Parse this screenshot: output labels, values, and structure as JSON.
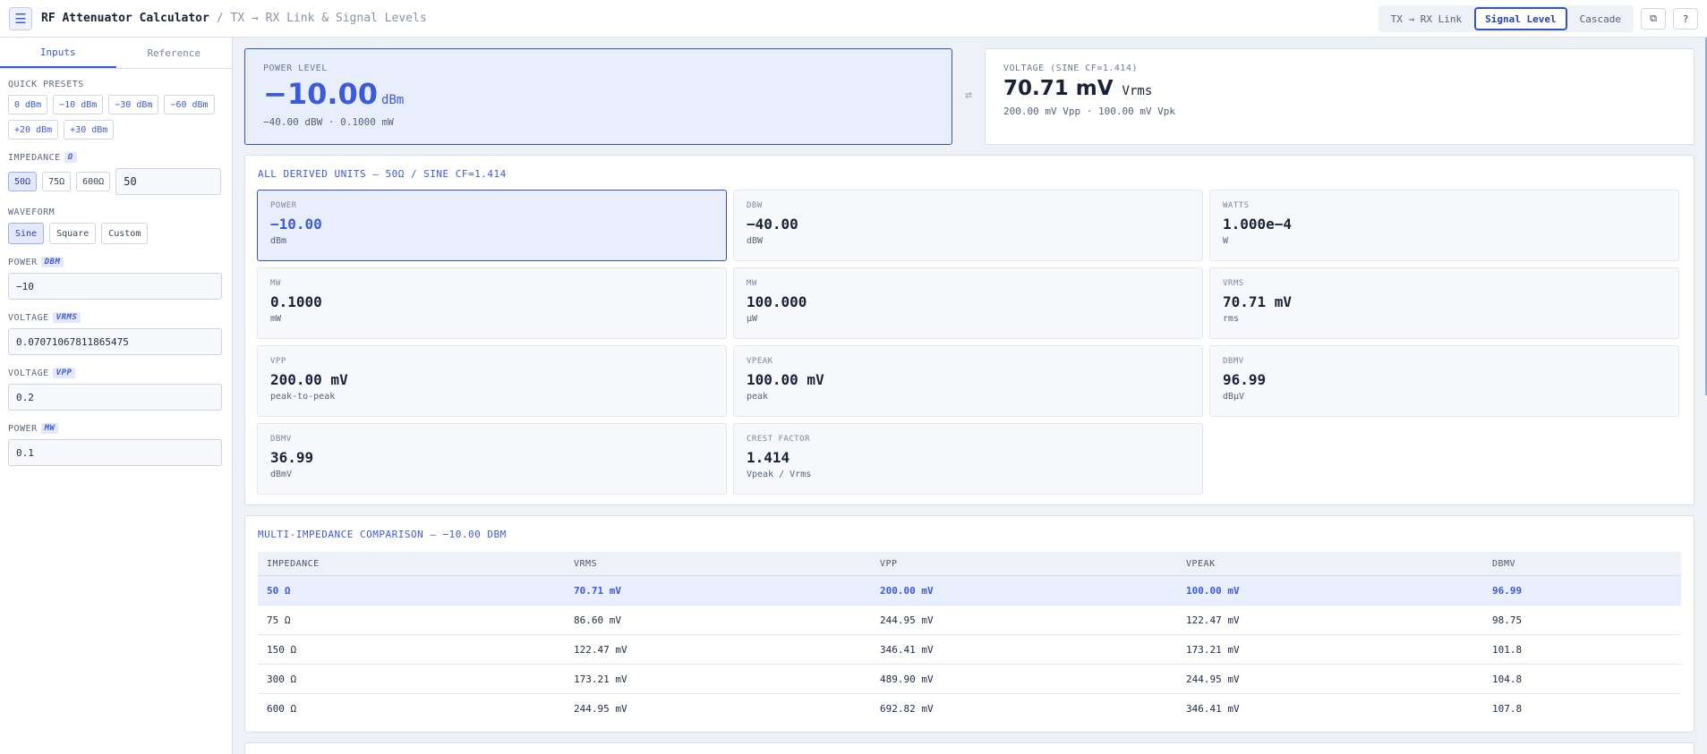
{
  "header": {
    "app_title": "RF Attenuator Calculator",
    "breadcrumb": "/ TX → RX Link & Signal Levels",
    "modes": [
      {
        "label": "TX → RX Link",
        "active": false
      },
      {
        "label": "Signal Level",
        "active": true
      },
      {
        "label": "Cascade",
        "active": false
      }
    ],
    "menu_icon": "hamburger-menu-icon",
    "copy_icon": "copy-icon",
    "help_icon": "help-icon"
  },
  "sidebar": {
    "tabs": [
      "Inputs",
      "Reference"
    ],
    "presets_label": "QUICK PRESETS",
    "presets": [
      "0 dBm",
      "−10 dBm",
      "−30 dBm",
      "−60 dBm",
      "+20 dBm",
      "+30 dBm"
    ],
    "impedance_label": "IMPEDANCE",
    "impedance_unit": "Ω",
    "impedance_options": [
      "50Ω",
      "75Ω",
      "600Ω"
    ],
    "impedance_value": "50",
    "waveform_label": "WAVEFORM",
    "waveform_options": [
      "Sine",
      "Square",
      "Custom"
    ],
    "fields": [
      {
        "label": "POWER",
        "unit": "DBM",
        "value": "−10"
      },
      {
        "label": "VOLTAGE",
        "unit": "VRMS",
        "value": "0.07071067811865475"
      },
      {
        "label": "VOLTAGE",
        "unit": "VPP",
        "value": "0.2"
      },
      {
        "label": "POWER",
        "unit": "MW",
        "value": "0.1"
      }
    ]
  },
  "power_card": {
    "label": "POWER LEVEL",
    "value": "−10.00",
    "unit": "dBm",
    "sub": "−40.00 dBW · 0.1000 mW"
  },
  "voltage_card": {
    "label": "VOLTAGE (SINE CF=1.414)",
    "value": "70.71 mV",
    "unit": "Vrms",
    "sub": "200.00 mV Vpp · 100.00 mV Vpk"
  },
  "swap_icon": "swap-arrows-icon",
  "derived": {
    "title": "ALL DERIVED UNITS — 50Ω / SINE CF=1.414",
    "cards": [
      {
        "label": "POWER",
        "value": "−10.00",
        "unit": "dBm"
      },
      {
        "label": "DBW",
        "value": "−40.00",
        "unit": "dBW"
      },
      {
        "label": "WATTS",
        "value": "1.000e−4",
        "unit": "W"
      },
      {
        "label": "MW",
        "value": "0.1000",
        "unit": "mW"
      },
      {
        "label": "MW",
        "value": "100.000",
        "unit": "µW"
      },
      {
        "label": "VRMS",
        "value": "70.71 mV",
        "unit": "rms"
      },
      {
        "label": "VPP",
        "value": "200.00 mV",
        "unit": "peak-to-peak"
      },
      {
        "label": "VPEAK",
        "value": "100.00 mV",
        "unit": "peak"
      },
      {
        "label": "DBMV",
        "value": "96.99",
        "unit": "dBµV"
      },
      {
        "label": "DBMV",
        "value": "36.99",
        "unit": "dBmV"
      },
      {
        "label": "CREST FACTOR",
        "value": "1.414",
        "unit": "Vpeak / Vrms"
      }
    ]
  },
  "comparison": {
    "title": "MULTI-IMPEDANCE COMPARISON — −10.00 DBM",
    "headers": [
      "IMPEDANCE",
      "VRMS",
      "VPP",
      "VPEAK",
      "DBMV"
    ],
    "rows": [
      [
        "50 Ω",
        "70.71 mV",
        "200.00 mV",
        "100.00 mV",
        "96.99"
      ],
      [
        "75 Ω",
        "86.60 mV",
        "244.95 mV",
        "122.47 mV",
        "98.75"
      ],
      [
        "150 Ω",
        "122.47 mV",
        "346.41 mV",
        "173.21 mV",
        "101.8"
      ],
      [
        "300 Ω",
        "173.21 mV",
        "489.90 mV",
        "244.95 mV",
        "104.8"
      ],
      [
        "600 Ω",
        "244.95 mV",
        "692.82 mV",
        "346.41 mV",
        "107.8"
      ]
    ]
  },
  "colors": {
    "accent": "#3b5bdb",
    "highlight_bg": "#e9eefc",
    "border": "#d9dee8"
  }
}
